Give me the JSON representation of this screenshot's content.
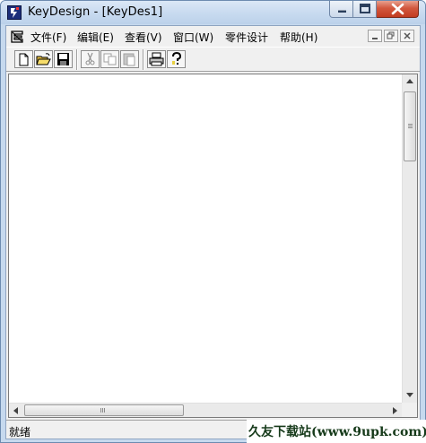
{
  "window": {
    "title": "KeyDesign - [KeyDes1]"
  },
  "menu": {
    "items": [
      "文件(F)",
      "编辑(E)",
      "查看(V)",
      "窗口(W)",
      "零件设计",
      "帮助(H)"
    ]
  },
  "toolbar": {
    "buttons": [
      "new",
      "open",
      "save",
      "cut",
      "copy",
      "paste",
      "print",
      "help"
    ]
  },
  "status": {
    "text": "就绪"
  },
  "watermark": {
    "text": "久友下载站(www.9upk.com)"
  },
  "colors": {
    "titlebar": "#c9dbf0",
    "close_button": "#c23b20",
    "chrome": "#f0f0f0"
  }
}
